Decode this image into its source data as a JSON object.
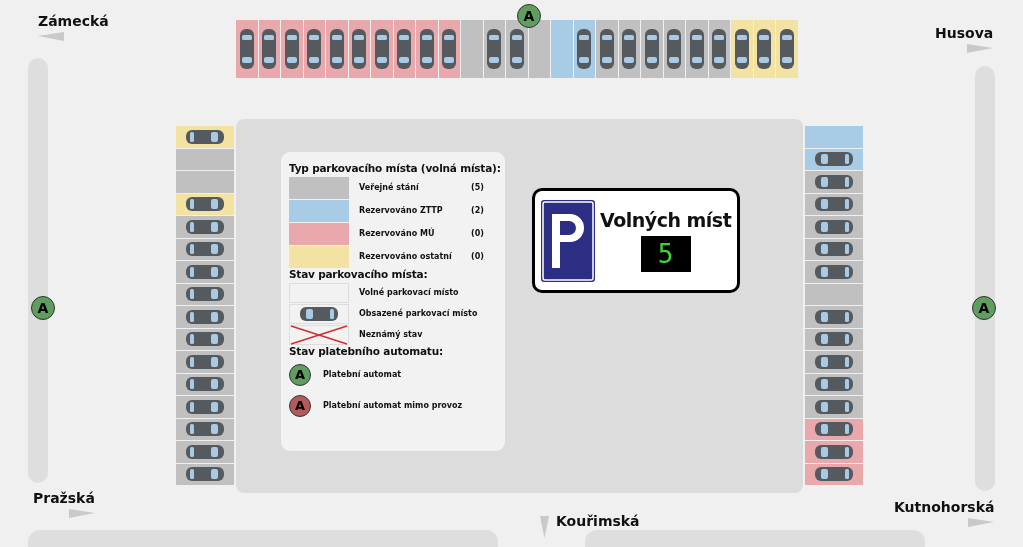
{
  "streets": [
    {
      "name": "Zámecká",
      "kind": "left"
    },
    {
      "name": "Husova",
      "kind": "right"
    },
    {
      "name": "Pražská",
      "kind": "right"
    },
    {
      "name": "Kouřimská",
      "kind": "down"
    },
    {
      "name": "Kutnohorská",
      "kind": "right"
    }
  ],
  "machines": [
    {
      "label": "A",
      "out_of_order": false
    },
    {
      "label": "A",
      "out_of_order": false
    },
    {
      "label": "A",
      "out_of_order": false
    }
  ],
  "parking": {
    "top": [
      {
        "kind": "mu",
        "occupied": true
      },
      {
        "kind": "mu",
        "occupied": true
      },
      {
        "kind": "mu",
        "occupied": true
      },
      {
        "kind": "mu",
        "occupied": true
      },
      {
        "kind": "mu",
        "occupied": true
      },
      {
        "kind": "mu",
        "occupied": true
      },
      {
        "kind": "mu",
        "occupied": true
      },
      {
        "kind": "mu",
        "occupied": true
      },
      {
        "kind": "mu",
        "occupied": true
      },
      {
        "kind": "mu",
        "occupied": true
      },
      {
        "kind": "public",
        "occupied": false
      },
      {
        "kind": "public",
        "occupied": true
      },
      {
        "kind": "public",
        "occupied": true
      },
      {
        "kind": "public",
        "occupied": false
      },
      {
        "kind": "ztp",
        "occupied": false
      },
      {
        "kind": "ztp",
        "occupied": true
      },
      {
        "kind": "public",
        "occupied": true
      },
      {
        "kind": "public",
        "occupied": true
      },
      {
        "kind": "public",
        "occupied": true
      },
      {
        "kind": "public",
        "occupied": true
      },
      {
        "kind": "public",
        "occupied": true
      },
      {
        "kind": "public",
        "occupied": true
      },
      {
        "kind": "other",
        "occupied": true
      },
      {
        "kind": "other",
        "occupied": true
      },
      {
        "kind": "other",
        "occupied": true
      }
    ],
    "left": [
      {
        "kind": "other",
        "occupied": true
      },
      {
        "kind": "public",
        "occupied": false
      },
      {
        "kind": "public",
        "occupied": false
      },
      {
        "kind": "other",
        "occupied": true
      },
      {
        "kind": "public",
        "occupied": true
      },
      {
        "kind": "public",
        "occupied": true
      },
      {
        "kind": "public",
        "occupied": true
      },
      {
        "kind": "public",
        "occupied": true
      },
      {
        "kind": "public",
        "occupied": true
      },
      {
        "kind": "public",
        "occupied": true
      },
      {
        "kind": "public",
        "occupied": true
      },
      {
        "kind": "public",
        "occupied": true
      },
      {
        "kind": "public",
        "occupied": true
      },
      {
        "kind": "public",
        "occupied": true
      },
      {
        "kind": "public",
        "occupied": true
      },
      {
        "kind": "public",
        "occupied": true
      }
    ],
    "right": [
      {
        "kind": "ztp",
        "occupied": false
      },
      {
        "kind": "ztp",
        "occupied": true
      },
      {
        "kind": "public",
        "occupied": true
      },
      {
        "kind": "public",
        "occupied": true
      },
      {
        "kind": "public",
        "occupied": true
      },
      {
        "kind": "public",
        "occupied": true
      },
      {
        "kind": "public",
        "occupied": true
      },
      {
        "kind": "public",
        "occupied": false
      },
      {
        "kind": "public",
        "occupied": true
      },
      {
        "kind": "public",
        "occupied": true
      },
      {
        "kind": "public",
        "occupied": true
      },
      {
        "kind": "public",
        "occupied": true
      },
      {
        "kind": "public",
        "occupied": true
      },
      {
        "kind": "mu",
        "occupied": true
      },
      {
        "kind": "mu",
        "occupied": true
      },
      {
        "kind": "mu",
        "occupied": true
      }
    ]
  },
  "legend": {
    "types_heading": "Typ parkovacího místa (volná místa):",
    "types": [
      {
        "kind": "public",
        "label": "Veřejné stání",
        "count": "(5)",
        "color": "#c0c0c0"
      },
      {
        "kind": "ztp",
        "label": "Rezervováno ZTTP",
        "count": "(2)",
        "color": "#a8cbe6"
      },
      {
        "kind": "mu",
        "label": "Rezervováno MÚ",
        "count": "(0)",
        "color": "#e8a8ac"
      },
      {
        "kind": "other",
        "label": "Rezervováno ostatní",
        "count": "(0)",
        "color": "#f3e3a3"
      }
    ],
    "states_heading": "Stav parkovacího místa:",
    "states": [
      {
        "kind": "free",
        "label": "Volné parkovací místo"
      },
      {
        "kind": "occupied",
        "label": "Obsazené parkovací místo"
      },
      {
        "kind": "unknown",
        "label": "Neznámý stav"
      }
    ],
    "machines_heading": "Stav platebního automatu:",
    "machines": [
      {
        "out_of_order": false,
        "symbol": "A",
        "label": "Platební automat"
      },
      {
        "out_of_order": true,
        "symbol": "A",
        "label": "Platební automat mimo provoz"
      }
    ]
  },
  "sign": {
    "title": "Volných míst",
    "count": "5"
  }
}
